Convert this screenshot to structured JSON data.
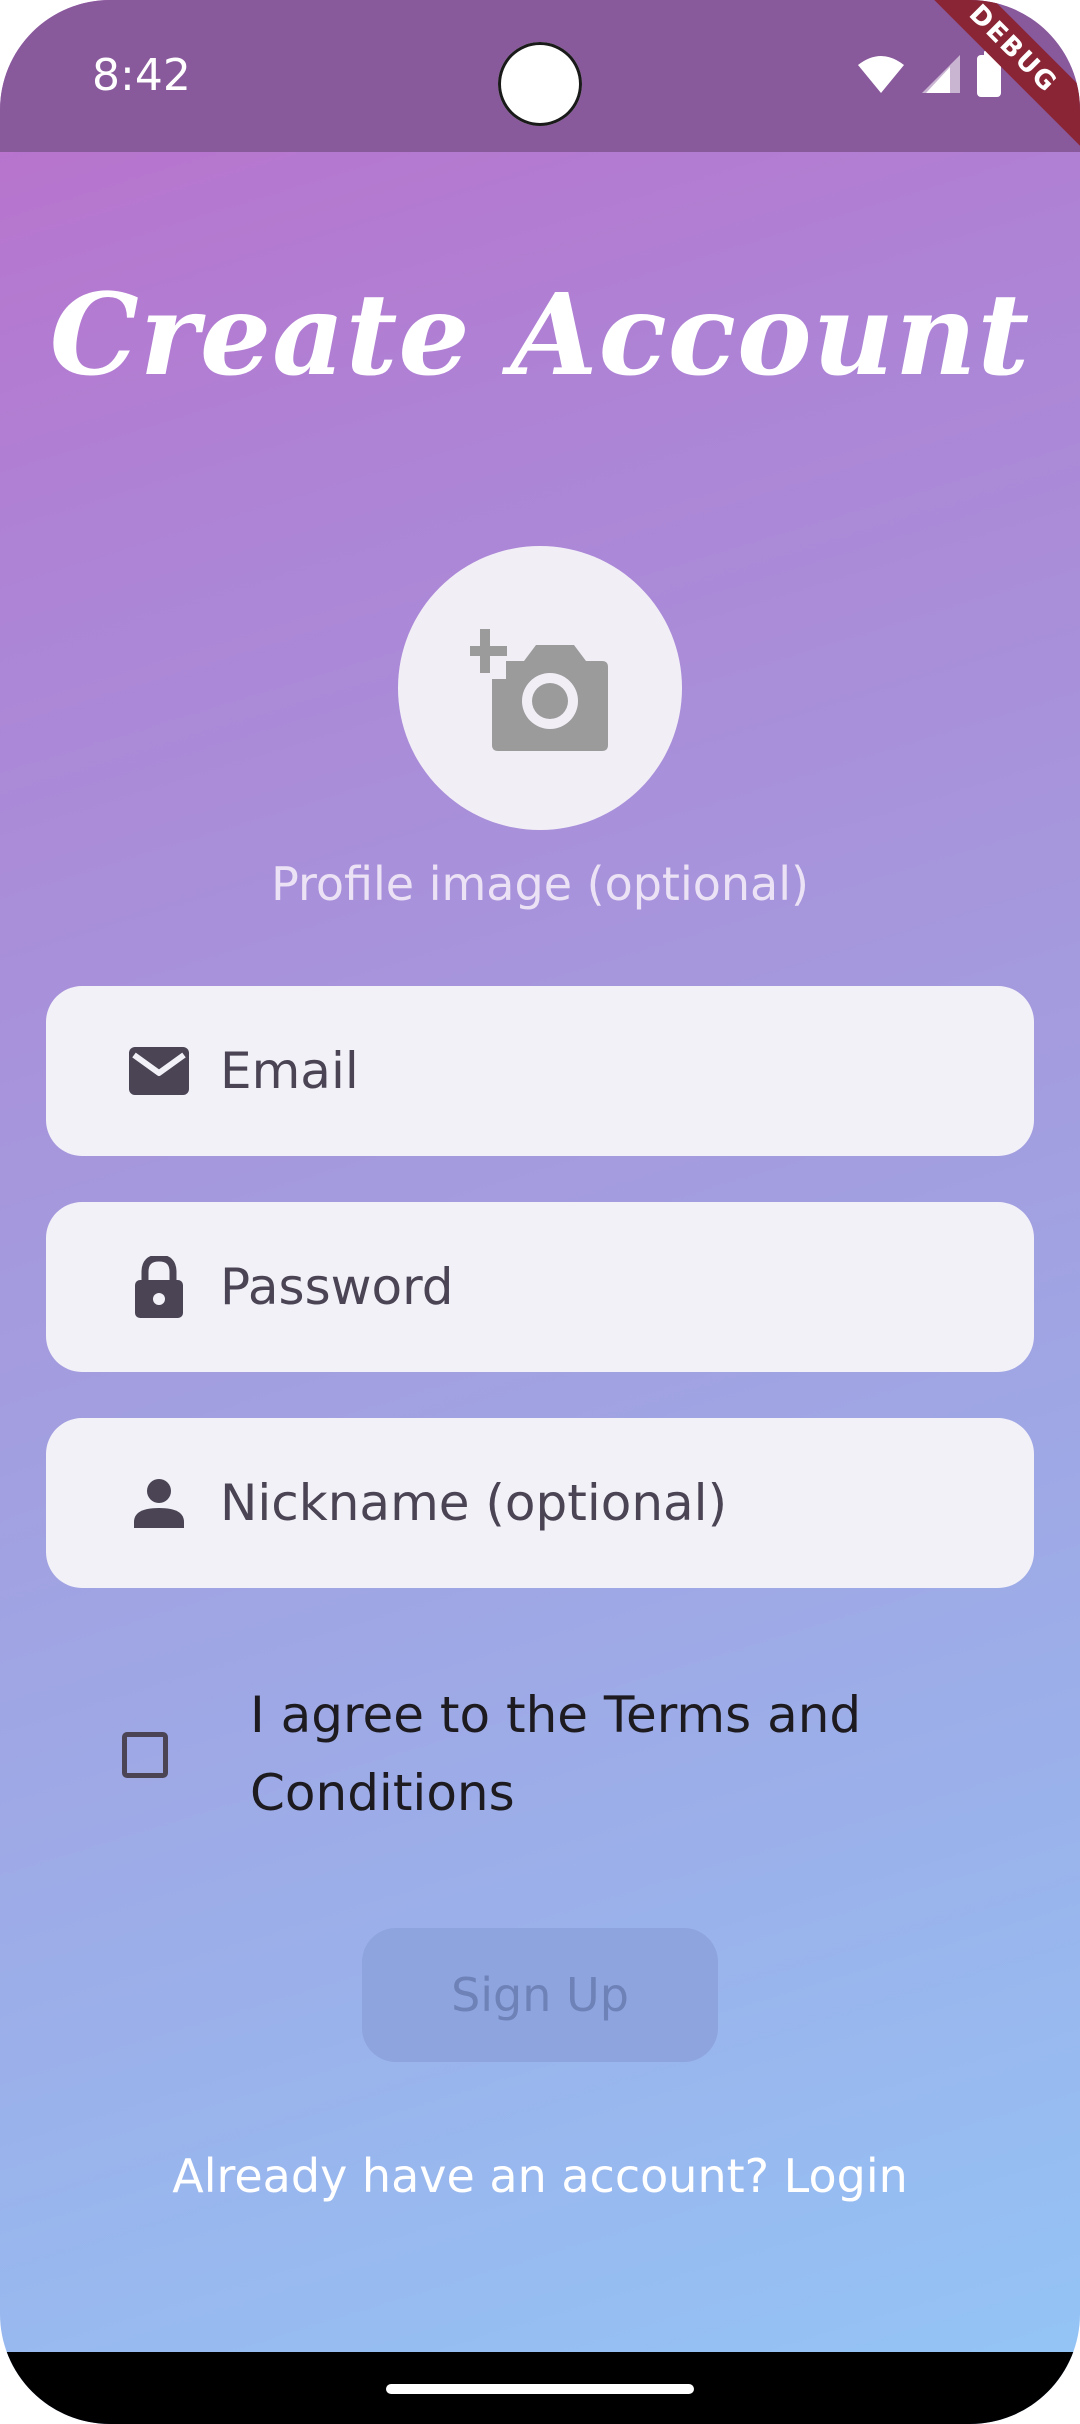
{
  "status_bar": {
    "time": "8:42",
    "debug_label": "DEBUG",
    "icons": [
      "wifi-icon",
      "signal-icon",
      "battery-icon"
    ]
  },
  "screen": {
    "title": "Create Account",
    "profile_image": {
      "icon": "add-a-photo-icon",
      "caption": "Profile image (optional)"
    },
    "fields": {
      "email": {
        "icon": "mail-icon",
        "placeholder": "Email",
        "value": ""
      },
      "password": {
        "icon": "lock-icon",
        "placeholder": "Password",
        "value": ""
      },
      "nickname": {
        "icon": "person-icon",
        "placeholder": "Nickname (optional)",
        "value": ""
      }
    },
    "terms": {
      "checked": false,
      "label": "I agree to the Terms and Conditions"
    },
    "signup_button": {
      "label": "Sign Up",
      "enabled": false
    },
    "login_link": "Already have an account? Login"
  },
  "colors": {
    "gradient_top": "#bb6fcb",
    "gradient_bottom": "#93c6f7",
    "status_bar": "#88599b",
    "field_background": "#f3f1f8",
    "icon_color": "#4a4454",
    "debug_banner": "#8a2535"
  }
}
